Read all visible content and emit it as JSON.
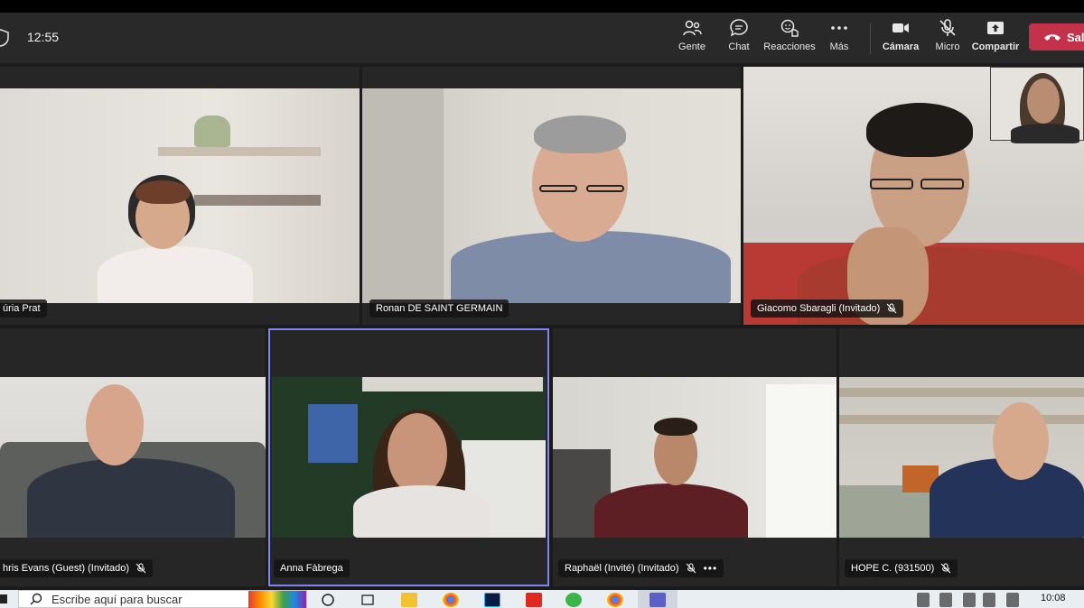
{
  "toolbar": {
    "time": "12:55",
    "people_label": "Gente",
    "chat_label": "Chat",
    "reactions_label": "Reacciones",
    "more_label": "Más",
    "camera_label": "Cámara",
    "mic_label": "Micro",
    "share_label": "Compartir",
    "leave_label": "Sal"
  },
  "participants": [
    {
      "name": "úria Prat",
      "muted": false
    },
    {
      "name": "Ronan DE SAINT GERMAIN",
      "muted": false
    },
    {
      "name": "Giacomo Sbaragli (Invitado)",
      "muted": true
    },
    {
      "name": "hris Evans (Guest) (Invitado)",
      "muted": true
    },
    {
      "name": "Anna Fàbrega",
      "muted": false
    },
    {
      "name": "Raphaël (Invité) (Invitado)",
      "muted": true
    },
    {
      "name": "HOPE C. (931500)",
      "muted": true
    }
  ],
  "taskbar": {
    "search_placeholder": "Escribe aquí para buscar",
    "time": "10:08"
  },
  "colors": {
    "leave": "#c4314b",
    "selected_outline": "#7f85f5",
    "toolbar_bg": "#292929"
  }
}
